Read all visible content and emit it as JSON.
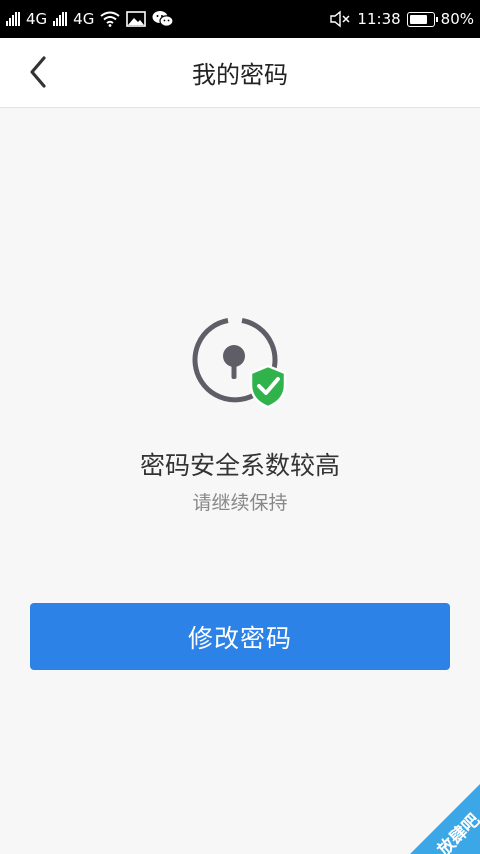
{
  "status_bar": {
    "sim1_network": "4G",
    "sim2_network": "4G",
    "time": "11:38",
    "battery_percent": "80%",
    "battery_level": 0.8,
    "icons": [
      "signal-icon",
      "wifi-icon",
      "image-notification-icon",
      "wechat-icon",
      "mute-icon",
      "battery-icon"
    ]
  },
  "header": {
    "title": "我的密码",
    "back_icon": "chevron-left-icon"
  },
  "main": {
    "status_icon": "lock-shield-check-icon",
    "headline": "密码安全系数较高",
    "subline": "请继续保持",
    "button_label": "修改密码"
  },
  "colors": {
    "accent": "#2d82e8",
    "shield": "#2fb34a",
    "lock": "#5f5d66"
  },
  "watermark": {
    "text": "放肆吧",
    "color": "#3ba7e6"
  }
}
